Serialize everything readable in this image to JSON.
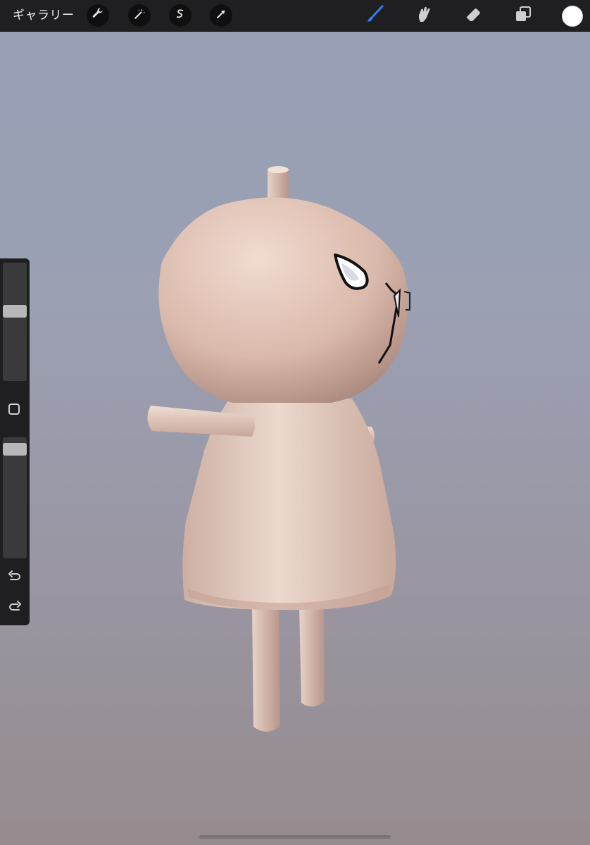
{
  "toolbar": {
    "gallery_label": "ギャラリー",
    "left_tools": [
      {
        "icon": "wrench-icon"
      },
      {
        "icon": "magic-wand-icon"
      },
      {
        "icon": "selection-icon"
      },
      {
        "icon": "transform-arrow-icon"
      }
    ],
    "right_tools": [
      {
        "icon": "brush-icon",
        "active": true
      },
      {
        "icon": "smudge-icon"
      },
      {
        "icon": "eraser-icon"
      },
      {
        "icon": "layers-icon"
      }
    ],
    "current_color": "#ffffff",
    "accent_color": "#2f7df6"
  },
  "sidebar": {
    "brush_size_level": 0.6,
    "opacity_level": 0.95,
    "icons": [
      "modify-square-icon",
      "undo-icon",
      "redo-icon"
    ]
  }
}
